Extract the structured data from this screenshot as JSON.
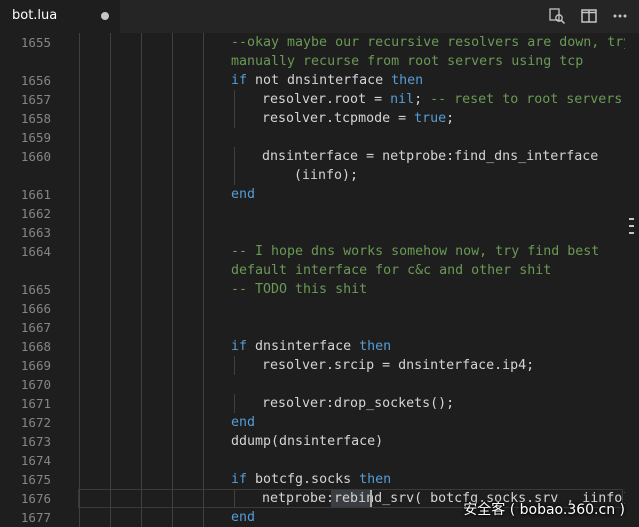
{
  "tab": {
    "filename": "bot.lua"
  },
  "toolbar": {
    "compare_icon": "open-changes-icon",
    "split_icon": "split-editor-icon",
    "more_icon": "more-actions-icon"
  },
  "colors": {
    "background": "#1e1e1e",
    "keyword": "#569cd6",
    "comment": "#6a9955",
    "identifier": "#d4d4d4",
    "line_number": "#858585"
  },
  "lines": [
    {
      "num": "1655",
      "indent": 0,
      "parts": [
        [
          "cmt",
          "--okay maybe our recursive resolvers are down, try"
        ]
      ],
      "wrap": [
        [
          "cmt",
          "manually recurse from root servers using tcp"
        ]
      ]
    },
    {
      "num": "1656",
      "indent": 0,
      "parts": [
        [
          "kw",
          "if"
        ],
        [
          "id",
          " not dnsinterface "
        ],
        [
          "kw",
          "then"
        ]
      ]
    },
    {
      "num": "1657",
      "indent": 1,
      "parts": [
        [
          "id",
          "resolver.root = "
        ],
        [
          "kw",
          "nil"
        ],
        [
          "id",
          "; "
        ],
        [
          "cmt",
          "-- reset to root servers"
        ]
      ]
    },
    {
      "num": "1658",
      "indent": 1,
      "parts": [
        [
          "id",
          "resolver.tcpmode = "
        ],
        [
          "kw",
          "true"
        ],
        [
          "id",
          ";"
        ]
      ]
    },
    {
      "num": "1659",
      "indent": 0,
      "parts": []
    },
    {
      "num": "1660",
      "indent": 1,
      "parts": [
        [
          "id",
          "dnsinterface = netprobe:find_dns_interface"
        ]
      ],
      "wrap": [
        [
          "id",
          "    (iinfo);"
        ]
      ]
    },
    {
      "num": "1661",
      "indent": 0,
      "parts": [
        [
          "kw",
          "end"
        ]
      ]
    },
    {
      "num": "1662",
      "indent": 0,
      "parts": []
    },
    {
      "num": "1663",
      "indent": 0,
      "parts": []
    },
    {
      "num": "1664",
      "indent": 0,
      "parts": [
        [
          "cmt",
          "-- I hope dns works somehow now, try find best"
        ]
      ],
      "wrap": [
        [
          "cmt",
          "default interface for c&c and other shit"
        ]
      ]
    },
    {
      "num": "1665",
      "indent": 0,
      "parts": [
        [
          "cmt",
          "-- TODO this shit"
        ]
      ]
    },
    {
      "num": "1666",
      "indent": 0,
      "parts": []
    },
    {
      "num": "1667",
      "indent": 0,
      "parts": []
    },
    {
      "num": "1668",
      "indent": 0,
      "parts": [
        [
          "kw",
          "if"
        ],
        [
          "id",
          " dnsinterface "
        ],
        [
          "kw",
          "then"
        ]
      ]
    },
    {
      "num": "1669",
      "indent": 1,
      "parts": [
        [
          "id",
          "resolver.srcip = dnsinterface.ip4;"
        ]
      ]
    },
    {
      "num": "1670",
      "indent": 0,
      "parts": []
    },
    {
      "num": "1671",
      "indent": 1,
      "parts": [
        [
          "id",
          "resolver:drop_sockets();"
        ]
      ]
    },
    {
      "num": "1672",
      "indent": 0,
      "parts": [
        [
          "kw",
          "end"
        ]
      ]
    },
    {
      "num": "1673",
      "indent": 0,
      "parts": [
        [
          "id",
          "ddump(dnsinterface)"
        ]
      ]
    },
    {
      "num": "1674",
      "indent": 0,
      "parts": []
    },
    {
      "num": "1675",
      "indent": 0,
      "parts": [
        [
          "kw",
          "if"
        ],
        [
          "id",
          " botcfg.socks "
        ],
        [
          "kw",
          "then"
        ]
      ]
    },
    {
      "num": "1676",
      "indent": 1,
      "parts": [
        [
          "id",
          "netprobe:rebind_srv( botcfg.socks.srv , iinfo)"
        ]
      ]
    },
    {
      "num": "1677",
      "indent": 0,
      "parts": [
        [
          "kw",
          "end"
        ]
      ]
    }
  ],
  "watermark": "安全客 ( bobao.360.cn )"
}
